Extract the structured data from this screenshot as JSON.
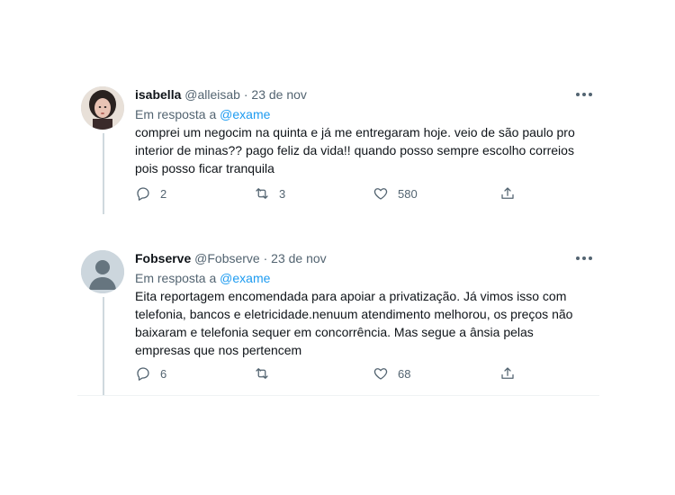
{
  "tweets": [
    {
      "name": "isabella",
      "handle": "@alleisab",
      "separator": "·",
      "date": "23 de nov",
      "reply_prefix": "Em resposta a",
      "reply_mention": "@exame",
      "text": "comprei um negocim na quinta e já me entregaram hoje. veio de são paulo pro interior de minas?? pago feliz da vida!! quando posso sempre escolho correios pois posso ficar tranquila",
      "replies": "2",
      "retweets": "3",
      "likes": "580",
      "avatar_icon": "user-photo-avatar"
    },
    {
      "name": "Fobserve",
      "handle": "@Fobserve",
      "separator": "·",
      "date": "23 de nov",
      "reply_prefix": "Em resposta a",
      "reply_mention": "@exame",
      "text": "Eita reportagem encomendada para apoiar a privatização. Já vimos isso com telefonia, bancos e eletricidade.nenuum atendimento melhorou, os preços não baixaram e telefonia sequer em concorrência. Mas segue a ânsia pelas empresas que nos pertencem",
      "replies": "6",
      "retweets": "",
      "likes": "68",
      "avatar_icon": "default-avatar"
    }
  ],
  "colors": {
    "text": "#0f1419",
    "secondary": "#536471",
    "link": "#1d9bf0",
    "thread_line": "#cfd9de"
  }
}
